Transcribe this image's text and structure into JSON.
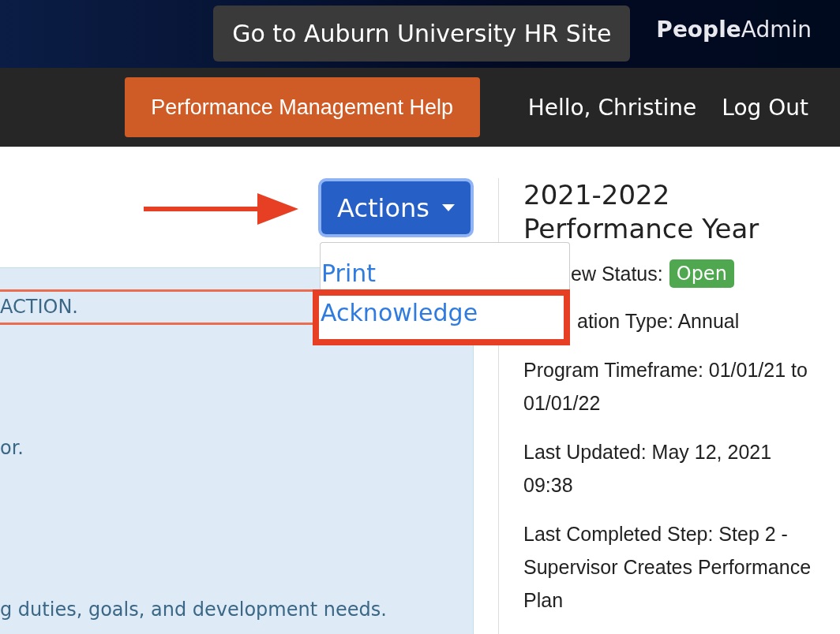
{
  "top_bar": {
    "hr_site_button": "Go to Auburn University HR Site",
    "logo": "**People**Admin"
  },
  "nav_bar": {
    "help_button": "Performance Management Help",
    "greeting": "Hello, Christine",
    "logout": "Log Out"
  },
  "actions": {
    "label": "Actions",
    "expanded": true,
    "pointer_arrow": true,
    "menu": [
      {
        "label": "Print",
        "annotated": false
      },
      {
        "label": "Acknowledge",
        "annotated": true
      }
    ]
  },
  "notice_panel": {
    "lines": [
      {
        "text": "ACTION.",
        "annotated": true
      },
      {
        "text": "or.",
        "annotated": false
      },
      {
        "text": "g duties, goals, and development needs.",
        "annotated": false
      }
    ]
  },
  "summary": {
    "title": "2021-2022 Performance Year",
    "status_label": "ew Status:",
    "status_badge": "Open",
    "facts": [
      "ation Type: Annual",
      "Program Timeframe: 01/01/21 to 01/01/22",
      "Last Updated: May 12, 2021 09:38",
      "Last Completed Step: Step 2 - Supervisor Creates Performance Plan"
    ]
  }
}
